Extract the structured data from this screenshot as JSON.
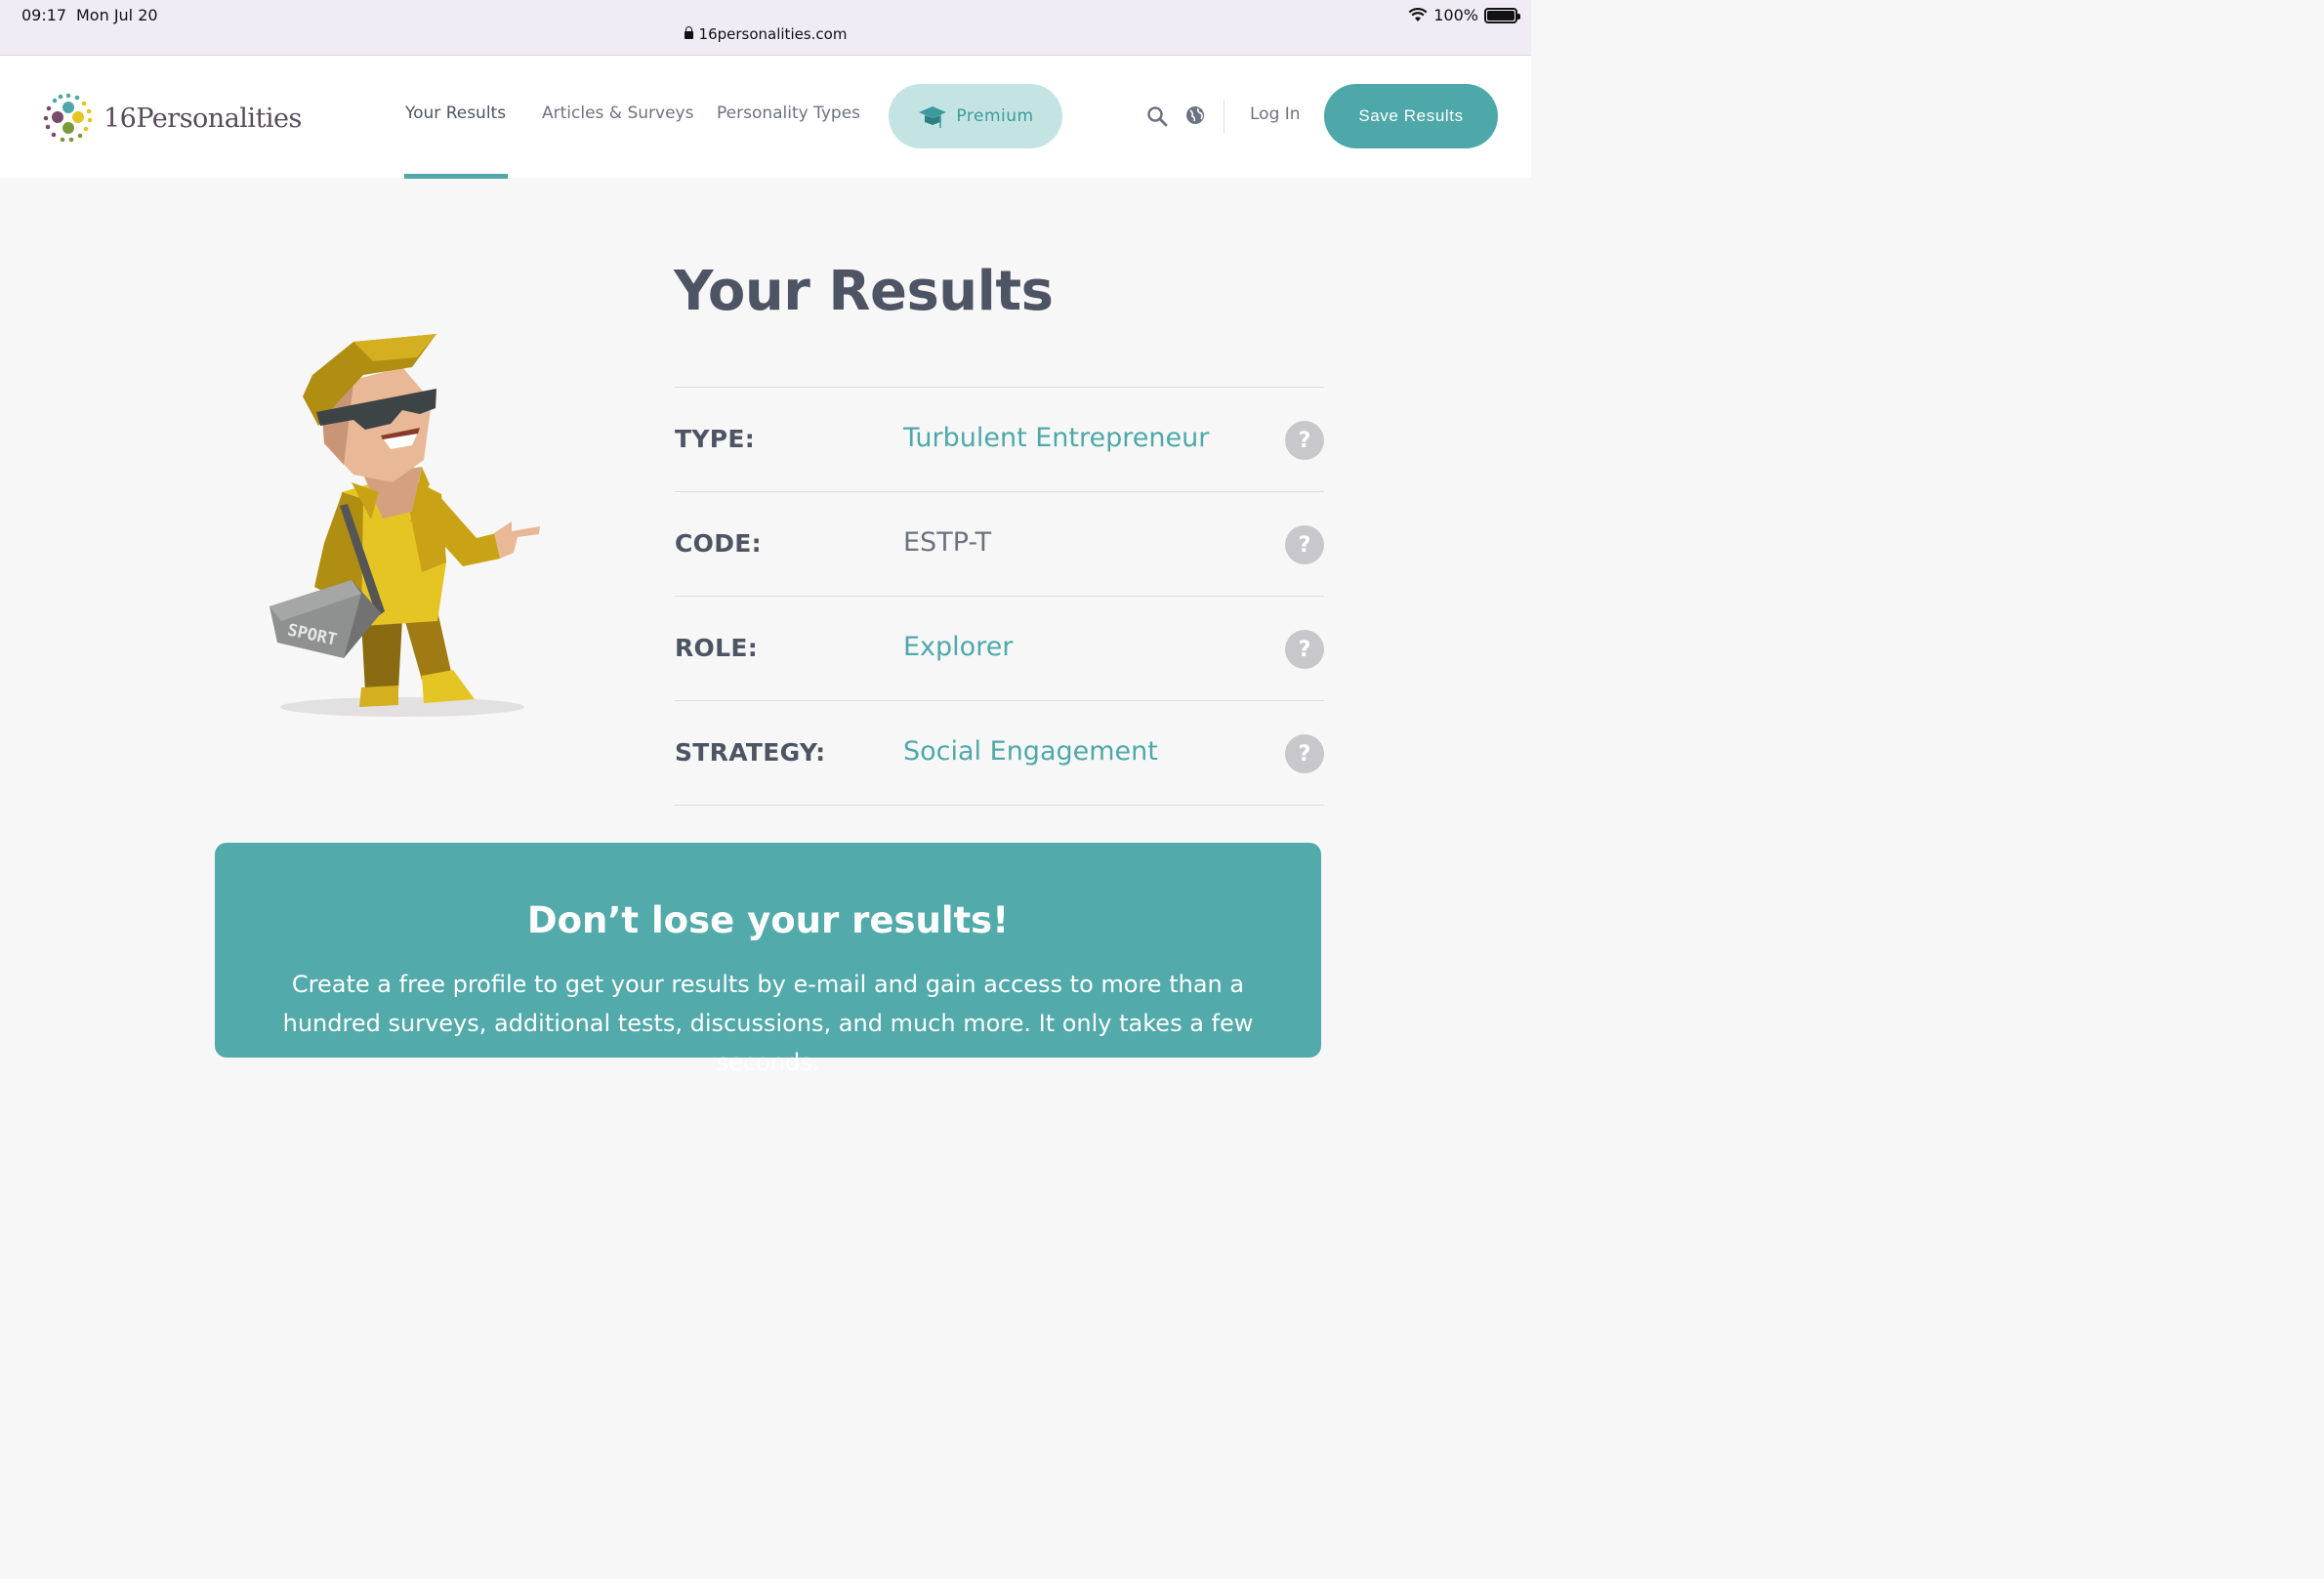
{
  "status_bar": {
    "time": "09:17",
    "date": "Mon Jul 20",
    "battery": "100%",
    "url": "16personalities.com"
  },
  "header": {
    "logo_text": "16Personalities",
    "nav": [
      "Your Results",
      "Articles & Surveys",
      "Personality Types"
    ],
    "premium_label": "Premium",
    "login_label": "Log In",
    "save_label": "Save Results"
  },
  "main": {
    "title": "Your Results",
    "rows": [
      {
        "label": "TYPE:",
        "value": "Turbulent Entrepreneur"
      },
      {
        "label": "CODE:",
        "value": "ESTP-T"
      },
      {
        "label": "ROLE:",
        "value": "Explorer"
      },
      {
        "label": "STRATEGY:",
        "value": "Social Engagement"
      }
    ],
    "character_bag_text": "SPORT"
  },
  "cta": {
    "title": "Don’t lose your results!",
    "text": "Create a free profile to get your results by e-mail and gain access to more than a hundred surveys, additional tests, discussions, and much more. It only takes a few seconds."
  },
  "colors": {
    "accent": "#4ea8aa",
    "premium_bg": "#c4e4e4",
    "text": "#4d5565",
    "cta_bg": "#52aaab"
  }
}
